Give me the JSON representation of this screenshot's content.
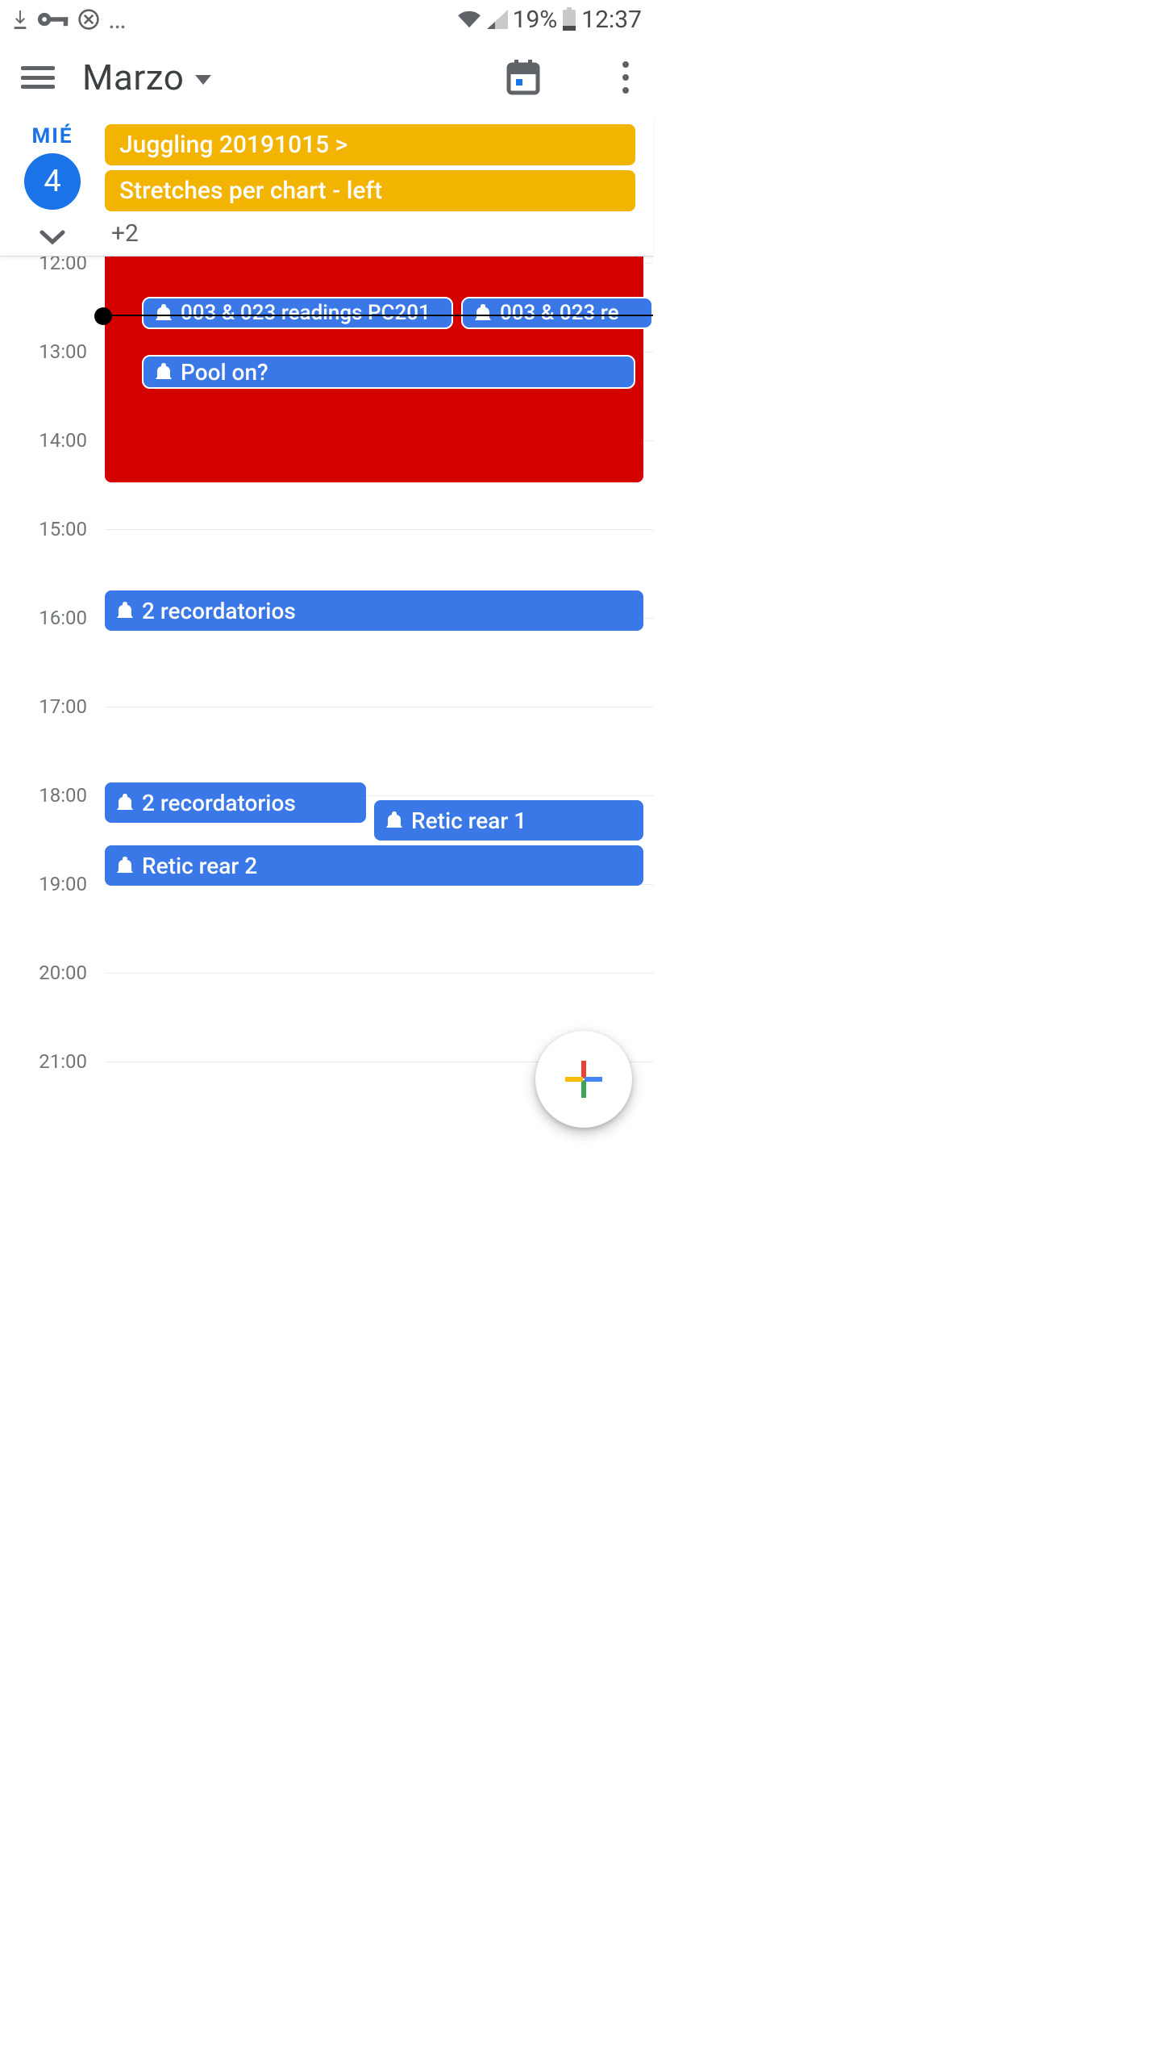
{
  "statusbar": {
    "battery": "19%",
    "time": "12:37"
  },
  "header": {
    "month": "Marzo"
  },
  "day": {
    "weekday": "MIÉ",
    "number": "4",
    "allday_events": [
      {
        "label": "Juggling 20191015 >"
      },
      {
        "label": "Stretches per chart - left"
      }
    ],
    "allday_more": "+2"
  },
  "hours": [
    "12:00",
    "13:00",
    "14:00",
    "15:00",
    "16:00",
    "17:00",
    "18:00",
    "19:00",
    "20:00",
    "21:00"
  ],
  "events": {
    "big_red": "",
    "r1a": "003 & 023 readings PC201",
    "r1b": "003 & 023 re",
    "pool": "Pool on?",
    "rem2a": "2 recordatorios",
    "rem2b": "2 recordatorios",
    "retic1": "Retic rear 1",
    "retic2": "Retic rear 2"
  }
}
